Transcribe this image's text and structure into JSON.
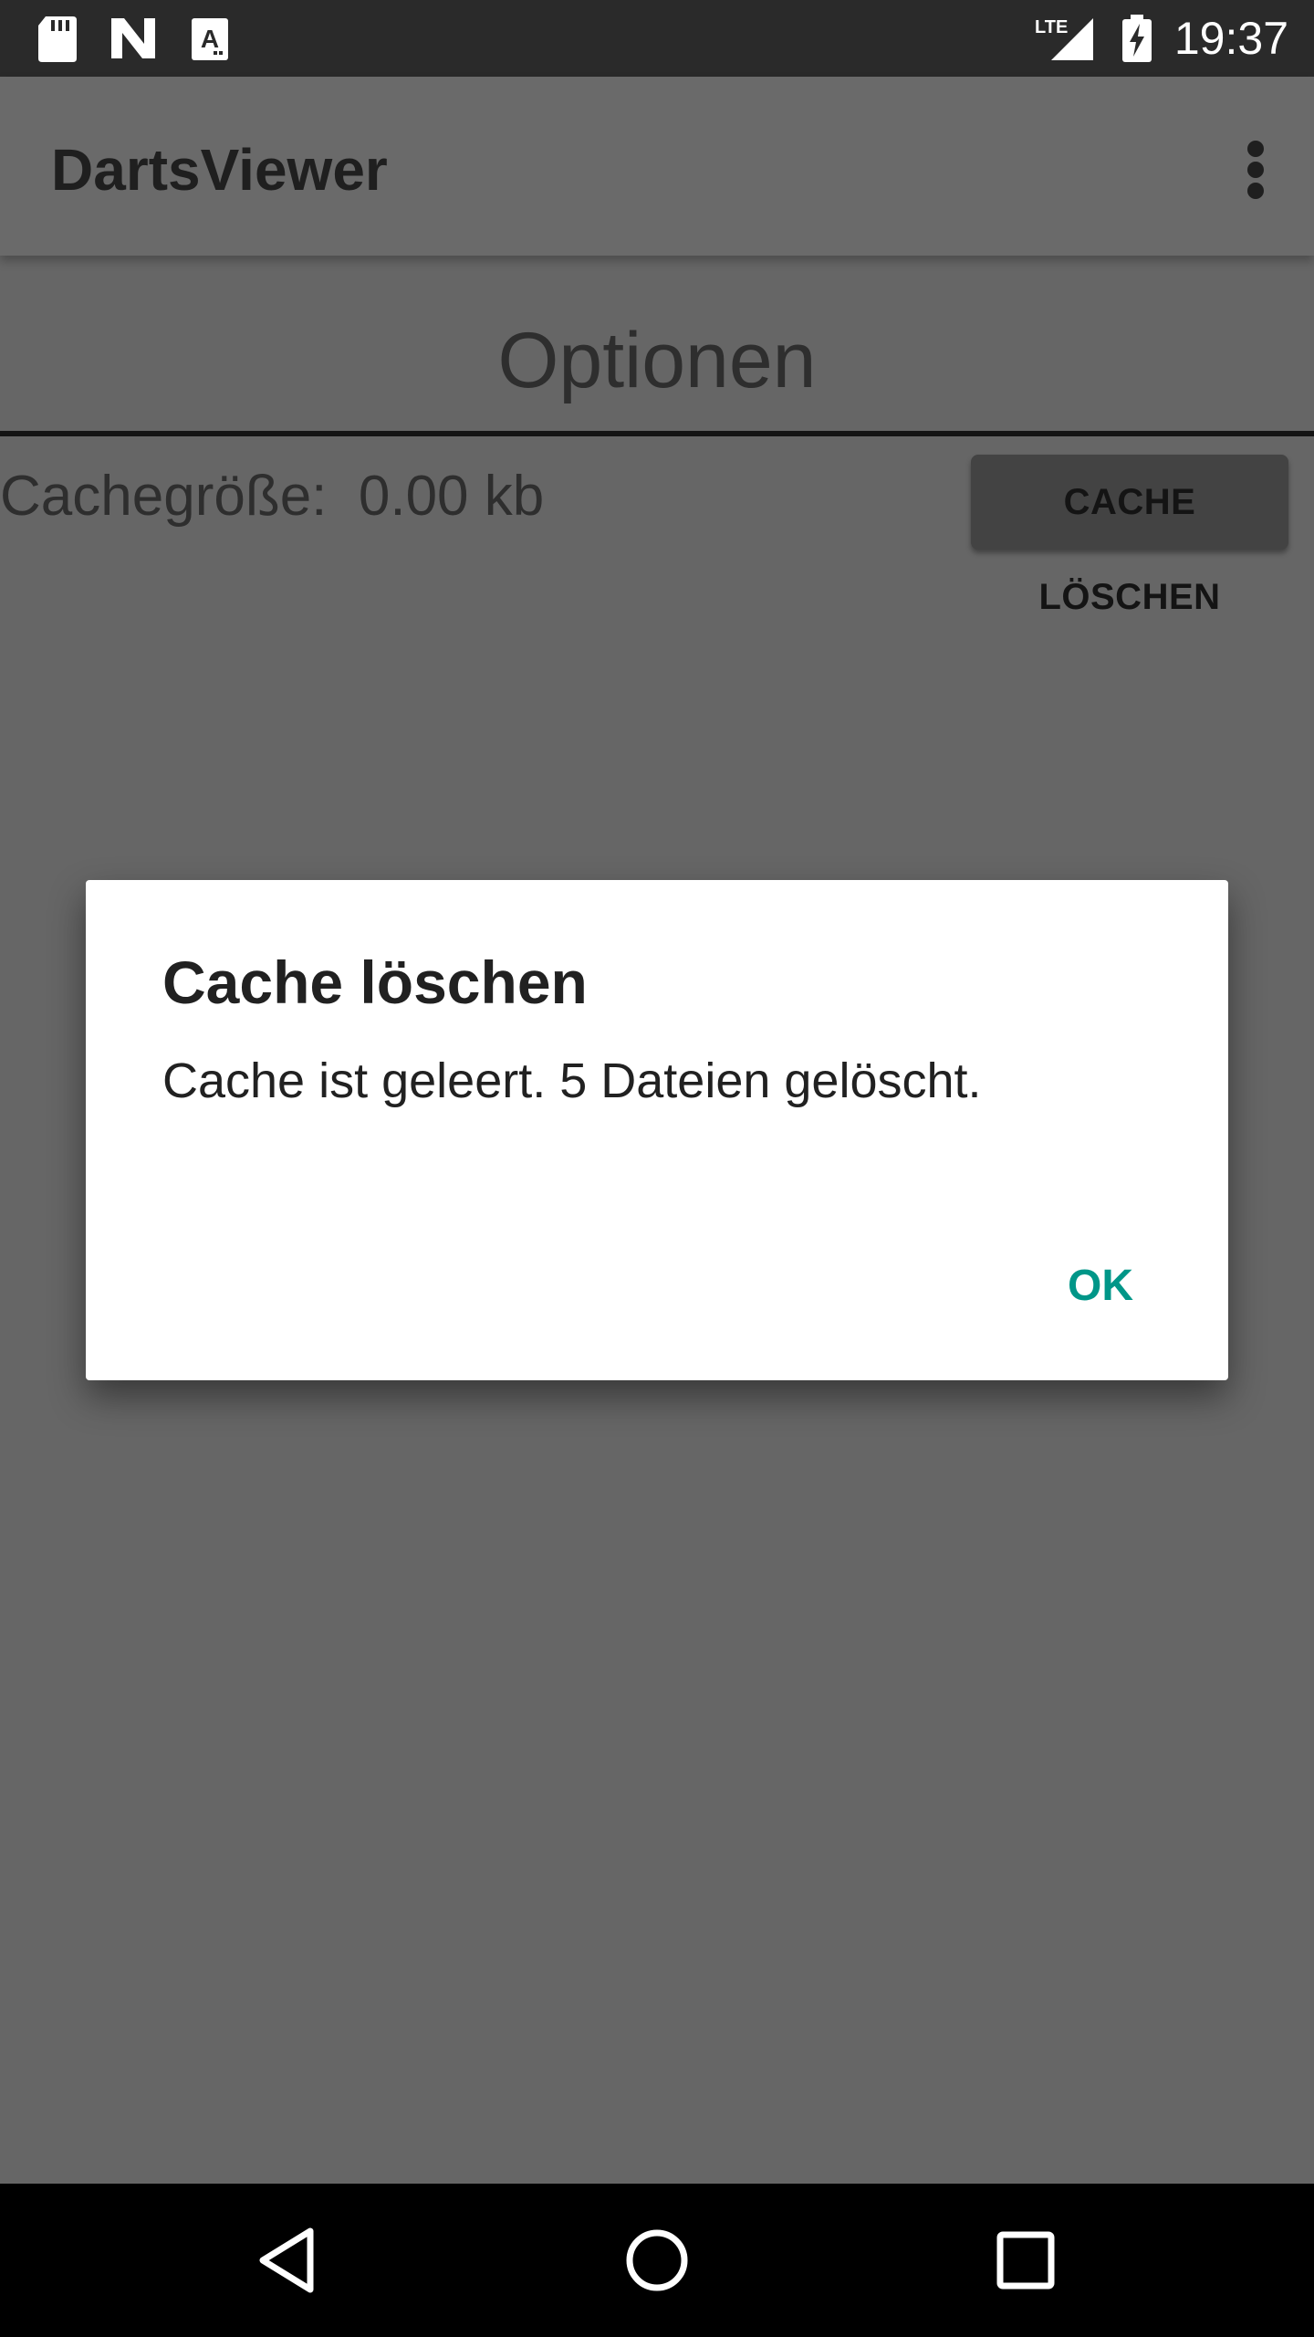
{
  "status_bar": {
    "time": "19:37",
    "icons": [
      "sd-card-icon",
      "n-notification-icon",
      "font-a-icon",
      "lte-signal-icon",
      "battery-charging-icon"
    ],
    "network_label": "LTE"
  },
  "app_bar": {
    "title": "DartsViewer",
    "menu_icon": "more-vert-icon"
  },
  "content": {
    "section_title": "Optionen",
    "cache_label": "Cachegröße:  0.00 kb",
    "clear_cache_button": "CACHE LÖSCHEN"
  },
  "dialog": {
    "title": "Cache löschen",
    "message": "Cache ist geleert. 5 Dateien gelöscht.",
    "ok_label": "OK",
    "accent_color": "#009688"
  },
  "nav_bar": {
    "icons": [
      "back-icon",
      "home-icon",
      "recents-icon"
    ]
  }
}
